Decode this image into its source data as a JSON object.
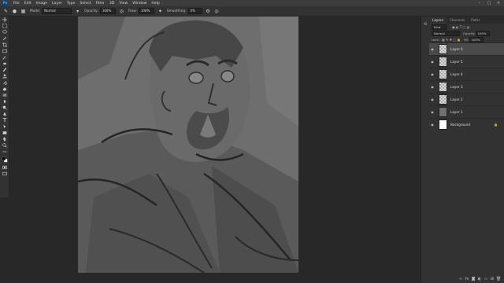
{
  "menubar": {
    "logo": "Ps",
    "items": [
      "File",
      "Edit",
      "Image",
      "Layer",
      "Type",
      "Select",
      "Filter",
      "3D",
      "View",
      "Window",
      "Help"
    ]
  },
  "options": {
    "mode_label": "Mode:",
    "mode_value": "Normal",
    "opacity_label": "Opacity:",
    "opacity_value": "100%",
    "flow_label": "Flow:",
    "flow_value": "100%",
    "smoothing_label": "Smoothing:",
    "smoothing_value": "0%"
  },
  "panel": {
    "tabs": [
      "Layers",
      "Channels",
      "Paths"
    ],
    "kind_label": "Kind",
    "blend_mode": "Normal",
    "opacity_label": "Opacity:",
    "opacity_value": "100%",
    "lock_label": "Lock:",
    "fill_label": "Fill:",
    "fill_value": "100%",
    "layers": [
      {
        "name": "Layer 6",
        "thumb": "checker",
        "selected": true
      },
      {
        "name": "Layer 5",
        "thumb": "checker",
        "selected": false
      },
      {
        "name": "Layer 4",
        "thumb": "checker",
        "selected": false
      },
      {
        "name": "Layer 3",
        "thumb": "checker",
        "selected": false
      },
      {
        "name": "Layer 2",
        "thumb": "checker",
        "selected": false
      },
      {
        "name": "Layer 1",
        "thumb": "gray",
        "selected": false
      },
      {
        "name": "Background",
        "thumb": "white",
        "selected": false,
        "locked": true
      }
    ]
  },
  "colors": {
    "accent": "#31a8ff",
    "doc_gray": "#6f6f6f"
  }
}
